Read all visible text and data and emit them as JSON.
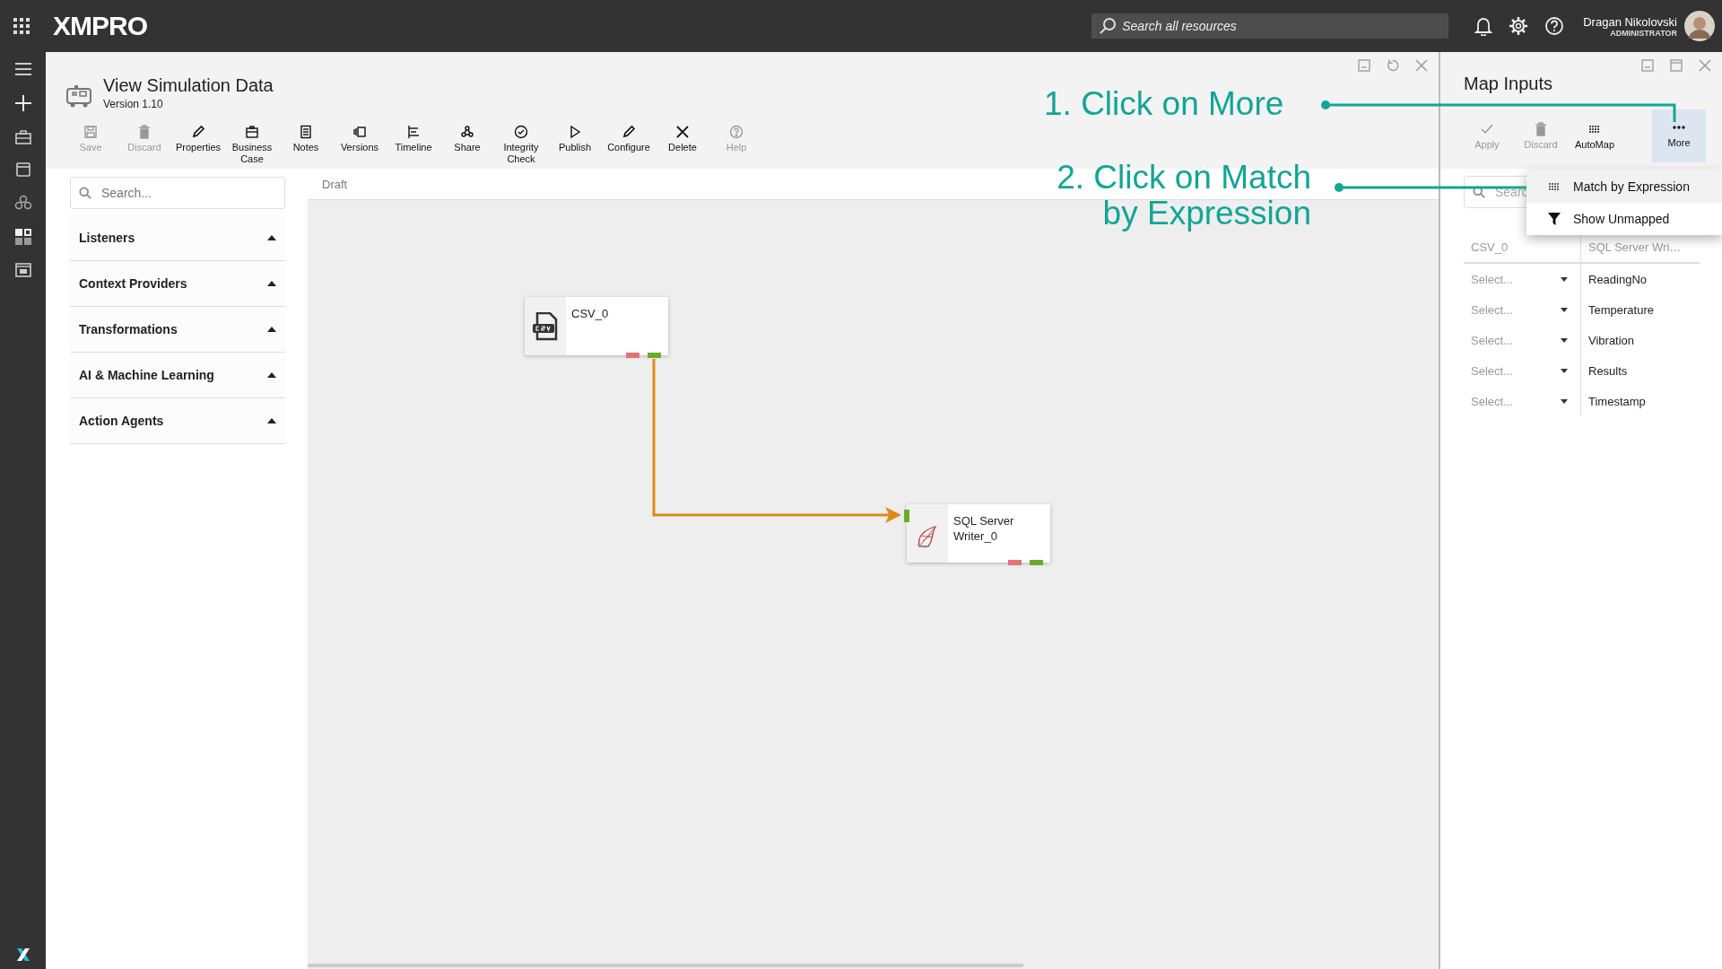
{
  "top_bar": {
    "logo": "XMPRO",
    "search": {
      "placeholder": "Search all resources"
    },
    "user": {
      "name": "Dragan Nikolovski",
      "role": "ADMINISTRATOR"
    }
  },
  "editor": {
    "title": "View Simulation Data",
    "version": "Version 1.10",
    "toolbar": [
      {
        "label": "Save",
        "kind": "save",
        "disabled": true
      },
      {
        "label": "Discard",
        "kind": "trash",
        "disabled": true
      },
      {
        "label": "Properties",
        "kind": "pencil",
        "disabled": false
      },
      {
        "label": "Business Case",
        "kind": "case",
        "disabled": false
      },
      {
        "label": "Notes",
        "kind": "notes",
        "disabled": false
      },
      {
        "label": "Versions",
        "kind": "versions",
        "disabled": false
      },
      {
        "label": "Timeline",
        "kind": "timeline",
        "disabled": false
      },
      {
        "label": "Share",
        "kind": "share",
        "disabled": false
      },
      {
        "label": "Integrity Check",
        "kind": "check",
        "disabled": false
      },
      {
        "label": "Publish",
        "kind": "play",
        "disabled": false
      },
      {
        "label": "Configure",
        "kind": "pencil",
        "disabled": false
      },
      {
        "label": "Delete",
        "kind": "x",
        "disabled": false
      },
      {
        "label": "Help",
        "kind": "help",
        "disabled": true
      }
    ],
    "palette": {
      "search": {
        "placeholder": "Search..."
      },
      "categories": [
        {
          "label": "Listeners",
          "expanded": true
        },
        {
          "label": "Context Providers",
          "expanded": true
        },
        {
          "label": "Transformations",
          "expanded": true
        },
        {
          "label": "AI & Machine Learning",
          "expanded": true
        },
        {
          "label": "Action Agents",
          "expanded": true
        }
      ]
    },
    "canvas": {
      "status": "Draft",
      "nodes": [
        {
          "label": "CSV_0",
          "kind": "csv"
        },
        {
          "label": "SQL Server Writer_0",
          "kind": "sql"
        }
      ]
    }
  },
  "map_inputs": {
    "title": "Map Inputs",
    "toolbar": [
      {
        "label": "Apply",
        "kind": "check",
        "disabled": true,
        "selected": false
      },
      {
        "label": "Discard",
        "kind": "trash",
        "disabled": true,
        "selected": false
      },
      {
        "label": "AutoMap",
        "kind": "lines",
        "disabled": false,
        "selected": false
      },
      {
        "label": "More",
        "kind": "dots",
        "disabled": false,
        "selected": true
      }
    ],
    "search": {
      "placeholder": "Searc"
    },
    "menu": [
      {
        "label": "Match by Expression",
        "kind": "lines",
        "highlighted": true
      },
      {
        "label": "Show Unmapped",
        "kind": "filter",
        "highlighted": false
      }
    ],
    "columns": [
      "CSV_0",
      "SQL Server Wri…"
    ],
    "rows": [
      {
        "source": "Select...",
        "target": "ReadingNo"
      },
      {
        "source": "Select...",
        "target": "Temperature"
      },
      {
        "source": "Select...",
        "target": "Vibration"
      },
      {
        "source": "Select...",
        "target": "Results"
      },
      {
        "source": "Select...",
        "target": "Timestamp"
      }
    ]
  },
  "annotations": [
    {
      "text": "1. Click on More"
    },
    {
      "text": "2. Click on Match\nby Expression"
    }
  ]
}
